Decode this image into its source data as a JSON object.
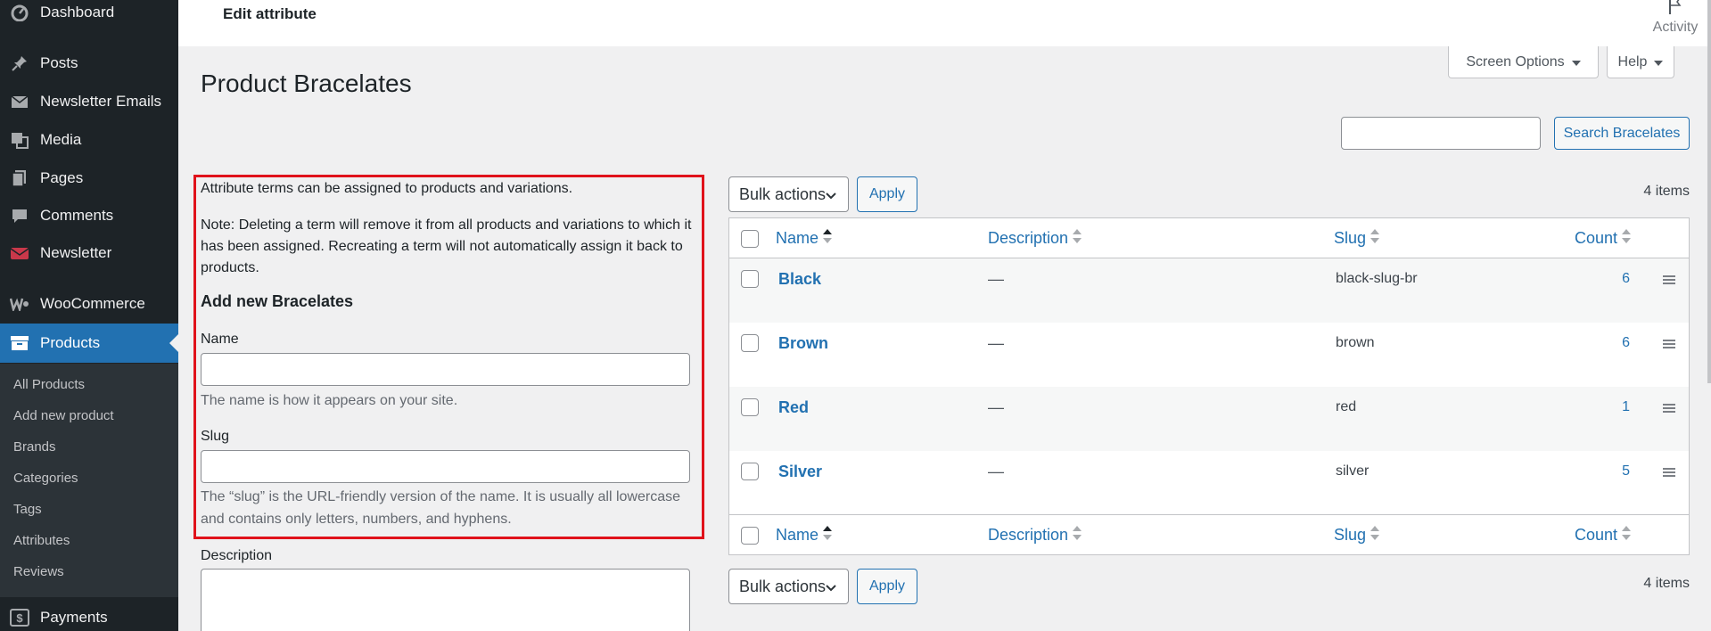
{
  "header": {
    "title": "Edit attribute",
    "activity_label": "Activity"
  },
  "screen_options": {
    "screen_options_label": "Screen Options",
    "help_label": "Help"
  },
  "sidebar": {
    "items": [
      {
        "label": "Dashboard",
        "icon": "dashboard-icon"
      },
      {
        "label": "Posts",
        "icon": "pin-icon"
      },
      {
        "label": "Newsletter Emails",
        "icon": "email-icon"
      },
      {
        "label": "Media",
        "icon": "media-icon"
      },
      {
        "label": "Pages",
        "icon": "pages-icon"
      },
      {
        "label": "Comments",
        "icon": "comments-icon"
      },
      {
        "label": "Newsletter",
        "icon": "newsletter-icon"
      },
      {
        "label": "WooCommerce",
        "icon": "woocommerce-icon"
      },
      {
        "label": "Products",
        "icon": "products-icon",
        "active": true
      },
      {
        "label": "Payments",
        "icon": "payments-icon"
      }
    ],
    "submenu": [
      "All Products",
      "Add new product",
      "Brands",
      "Categories",
      "Tags",
      "Attributes",
      "Reviews"
    ]
  },
  "page": {
    "title": "Product Bracelates",
    "search_button": "Search Bracelates",
    "search_value": ""
  },
  "form": {
    "intro": "Attribute terms can be assigned to products and variations.",
    "note_line1": "Note: Deleting a term will remove it from all products and variations to which it",
    "note_line2": "has been assigned. Recreating a term will not automatically assign it back to",
    "note_line3": "products.",
    "heading": "Add new Bracelates",
    "name_label": "Name",
    "name_value": "",
    "name_help": "The name is how it appears on your site.",
    "slug_label": "Slug",
    "slug_value": "",
    "slug_help_line1": "The “slug” is the URL-friendly version of the name. It is usually all lowercase",
    "slug_help_line2": "and contains only letters, numbers, and hyphens.",
    "description_label": "Description"
  },
  "table": {
    "bulk_actions": "Bulk actions",
    "apply": "Apply",
    "items_count": "4 items",
    "columns": [
      "Name",
      "Description",
      "Slug",
      "Count"
    ],
    "rows": [
      {
        "name": "Black",
        "description": "—",
        "slug": "black-slug-br",
        "count": "6"
      },
      {
        "name": "Brown",
        "description": "—",
        "slug": "brown",
        "count": "6"
      },
      {
        "name": "Red",
        "description": "—",
        "slug": "red",
        "count": "1"
      },
      {
        "name": "Silver",
        "description": "—",
        "slug": "silver",
        "count": "5"
      }
    ]
  },
  "colors": {
    "accent": "#2271b1",
    "sidebar_bg": "#1d2327",
    "highlight": "#e0121b"
  }
}
